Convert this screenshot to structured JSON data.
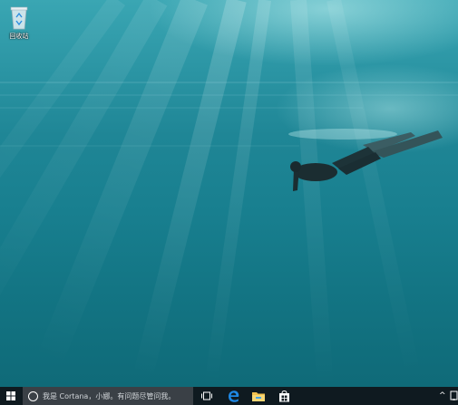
{
  "desktop": {
    "icons": [
      {
        "label": "回收站",
        "icon": "recycle-bin-icon"
      }
    ]
  },
  "taskbar": {
    "start_icon": "windows-logo-icon",
    "search_placeholder": "我是 Cortana，小娜。有问题尽管问我。",
    "buttons": [
      {
        "name": "task-view",
        "icon": "task-view-icon"
      },
      {
        "name": "edge",
        "icon": "edge-icon"
      },
      {
        "name": "file-explorer",
        "icon": "folder-icon"
      },
      {
        "name": "store",
        "icon": "store-icon"
      }
    ],
    "tray": {
      "chevron": "^"
    }
  },
  "colors": {
    "taskbar_bg": "#0f1a20",
    "search_bg": "#3a4046",
    "accent_blue": "#1e88e5",
    "water_top": "#3aa6b3",
    "water_bottom": "#0f6a78"
  }
}
